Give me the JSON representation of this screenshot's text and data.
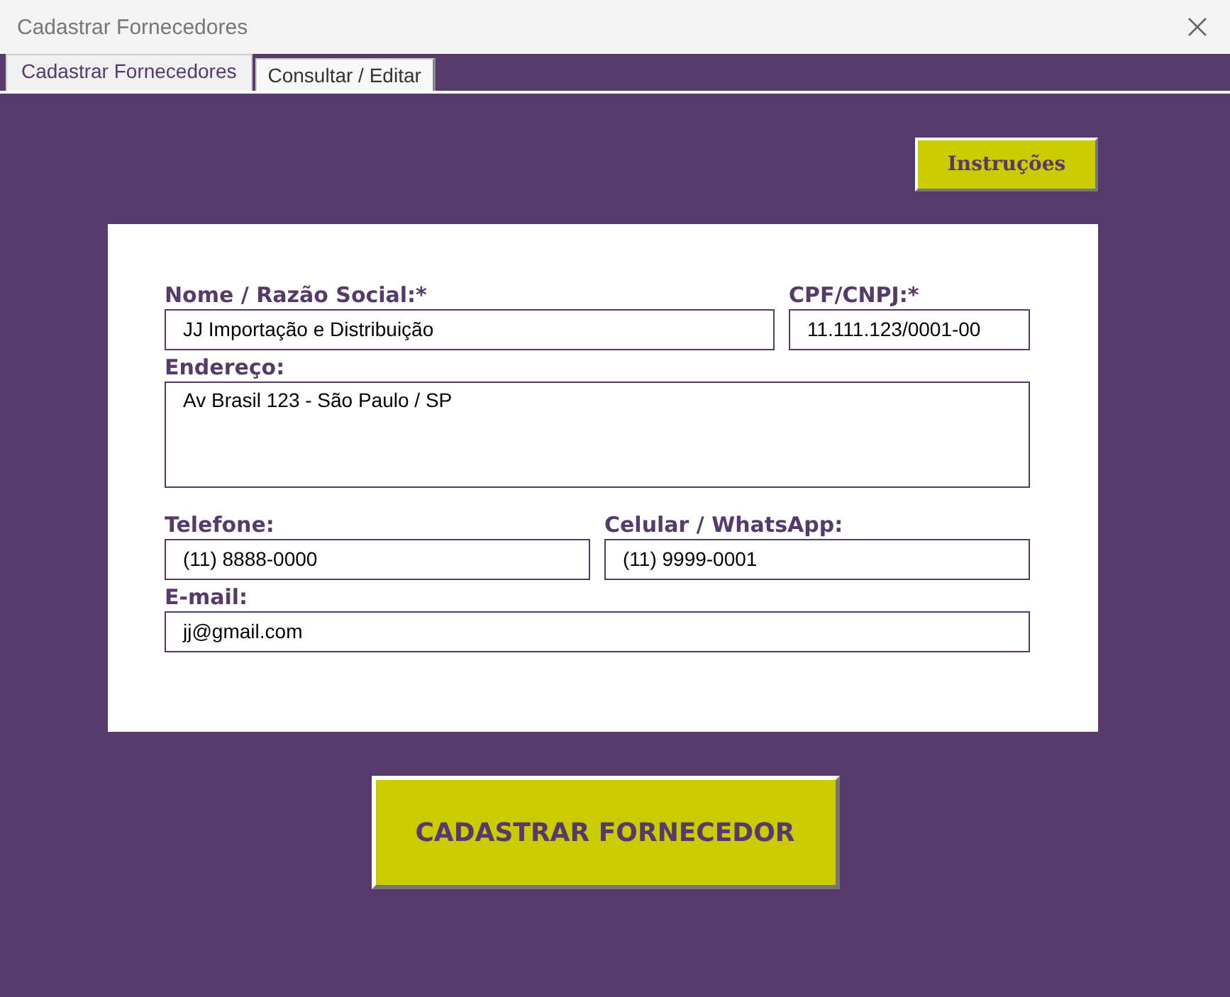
{
  "window": {
    "title": "Cadastrar Fornecedores"
  },
  "tabs": [
    {
      "label": "Cadastrar Fornecedores",
      "selected": true
    },
    {
      "label": "Consultar / Editar",
      "selected": false
    }
  ],
  "instructions_button": "Instruções",
  "form": {
    "rows": [
      [
        {
          "label": "Nome / Razão Social:*",
          "value": "JJ Importação e Distribuição",
          "kind": "text"
        },
        {
          "label": "CPF/CNPJ:*",
          "value": "11.111.123/0001-00",
          "kind": "document"
        }
      ],
      [
        {
          "label": "Endereço:",
          "value": "Av Brasil 123 - São Paulo / SP",
          "kind": "multiline"
        }
      ],
      [
        {
          "label": "Telefone:",
          "value": "(11) 8888-0000",
          "kind": "text"
        },
        {
          "label": "Celular / WhatsApp:",
          "value": "(11) 9999-0001",
          "kind": "text"
        }
      ],
      [
        {
          "label": "E-mail:",
          "value": "jj@gmail.com",
          "kind": "text"
        }
      ]
    ]
  },
  "submit_button": "CADASTRAR FORNECEDOR"
}
